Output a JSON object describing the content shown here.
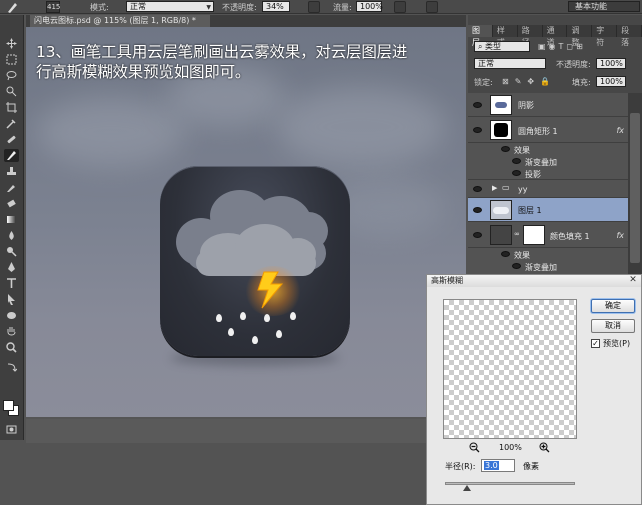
{
  "options_bar": {
    "brush_size": "415",
    "mode_label": "模式:",
    "mode_value": "正常",
    "opacity_label": "不透明度:",
    "opacity_value": "34%",
    "flow_label": "流量:",
    "flow_value": "100%",
    "workspace": "基本功能"
  },
  "document": {
    "tab_title": "闪电云图标.psd @ 115% (图层 1, RGB/8) *"
  },
  "instruction": {
    "line1": "13、画笔工具用云层笔刷画出云雾效果，对云层图层进",
    "line2": "行高斯模糊效果预览如图即可。"
  },
  "layers_panel": {
    "tabs": [
      "图层",
      "样式",
      "路径",
      "通道",
      "调整",
      "字符",
      "段落"
    ],
    "filter_value": "类型",
    "blend_mode": "正常",
    "opacity_label": "不透明度:",
    "opacity_value": "100%",
    "lock_label": "锁定:",
    "fill_label": "填充:",
    "fill_value": "100%",
    "layers": [
      {
        "name": "阴影",
        "fx": ""
      },
      {
        "name": "圆角矩形 1",
        "fx": "fx"
      },
      {
        "name": "效果",
        "fx": ""
      },
      {
        "name": "渐变叠加",
        "fx": ""
      },
      {
        "name": "投影",
        "fx": ""
      },
      {
        "name": "yy",
        "fx": ""
      },
      {
        "name": "图层 1",
        "fx": ""
      },
      {
        "name": "颜色填充 1",
        "fx": "fx"
      },
      {
        "name": "效果",
        "fx": ""
      },
      {
        "name": "渐变叠加",
        "fx": ""
      }
    ]
  },
  "dialog": {
    "title": "高斯模糊",
    "ok": "确定",
    "cancel": "取消",
    "preview_label": "预览(P)",
    "preview_checked": "✓",
    "zoom": "100%",
    "radius_label": "半径(R):",
    "radius_value": "3.0",
    "unit": "像素"
  },
  "colors": {
    "accent": "#8ea3c8",
    "lightning": "#ffcc1a",
    "glow": "#ff9a20"
  }
}
